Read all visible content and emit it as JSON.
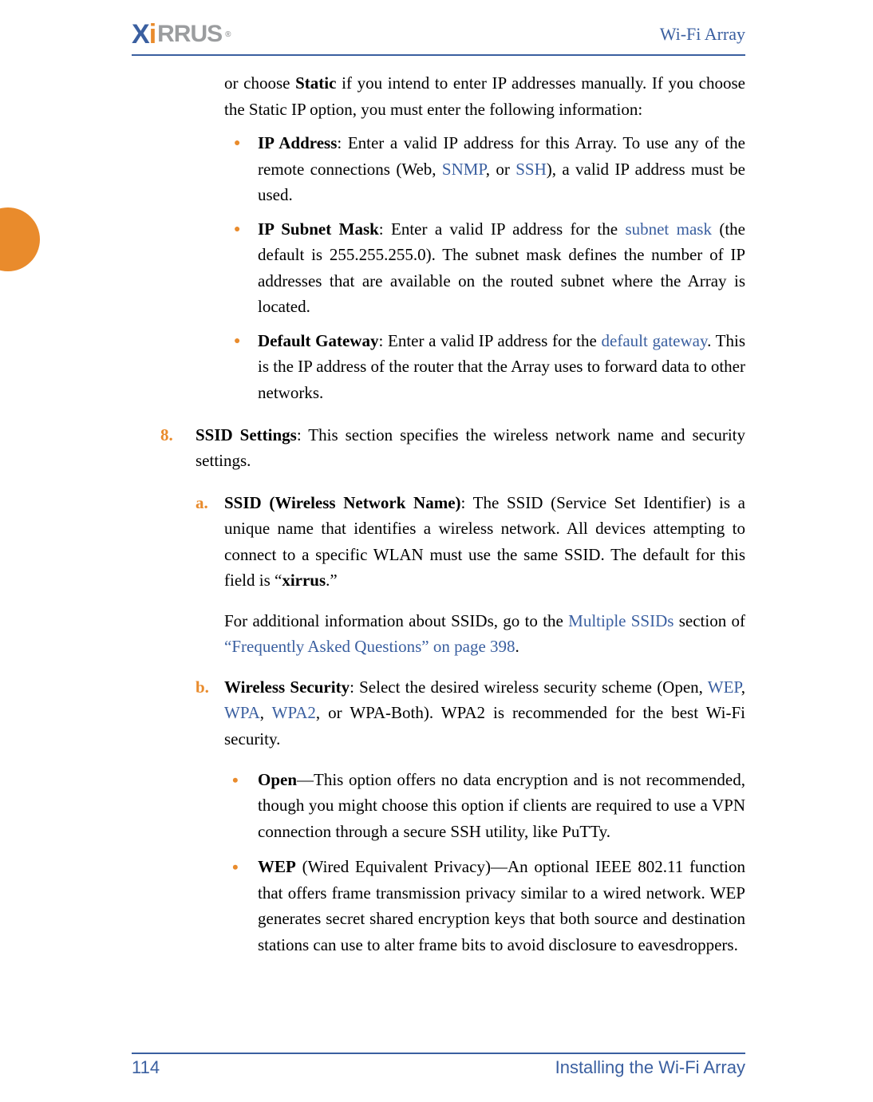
{
  "header": {
    "logo_text_prefix": "X",
    "logo_text_mid": "RRUS",
    "title": "Wi-Fi Array"
  },
  "intro": {
    "prefix": "or choose ",
    "bold1": "Static",
    "suffix": " if you intend to enter IP addresses manually. If you choose the Static IP option, you must enter the following information:"
  },
  "bullets": [
    {
      "label": "IP Address",
      "t1": ": Enter a valid IP address for this Array. To use any of the remote connections (Web, ",
      "link1": "SNMP",
      "t2": ", or ",
      "link2": "SSH",
      "t3": "), a valid IP address must be used."
    },
    {
      "label": "IP Subnet Mask",
      "t1": ": Enter a valid IP address for the ",
      "link1": "subnet mask",
      "t2": " (the default is 255.255.255.0). The subnet mask defines the number of IP addresses that are available on the routed subnet where the Array is located."
    },
    {
      "label": "Default Gateway",
      "t1": ": Enter a valid IP address for the ",
      "link1": "default gateway",
      "t2": ". This is the IP address of the router that the Array uses to forward data to other networks."
    }
  ],
  "step8": {
    "num": "8.",
    "label": "SSID Settings",
    "body": ": This section specifies the wireless network name and security settings."
  },
  "sub_a": {
    "letter": "a.",
    "label": "SSID (Wireless Network Name)",
    "t1": ": The SSID (Service Set Identifier) is a unique name that identifies a wireless network. All devices attempting to connect to a specific WLAN must use the same SSID. The default for this field is “",
    "bold_inside": "xirrus",
    "t1b": ".”",
    "p2_pre": "For additional information about SSIDs, go to the ",
    "p2_link1": "Multiple SSIDs",
    "p2_mid": " section of ",
    "p2_link2": "“Frequently Asked Questions” on page 398",
    "p2_end": "."
  },
  "sub_b": {
    "letter": "b.",
    "label": "Wireless Security",
    "t1": ": Select the desired wireless security scheme (Open, ",
    "link1": "WEP",
    "t2": ", ",
    "link2": "WPA",
    "t3": ", ",
    "link3": "WPA2",
    "t4": ", or WPA-Both). WPA2 is recommended for the best Wi-Fi security."
  },
  "inner_items": [
    {
      "label": "Open",
      "body": "—This option offers no data encryption and is not recommended, though you might choose this option if clients are required to use a VPN connection through a secure SSH utility, like PuTTy."
    },
    {
      "label": "WEP",
      "body": " (Wired Equivalent Privacy)—An optional IEEE 802.11 function that offers frame transmission privacy similar to a wired network. WEP generates secret shared encryption keys that both source and destination stations can use to alter frame bits to avoid disclosure to eavesdroppers."
    }
  ],
  "footer": {
    "page": "114",
    "section": "Installing the Wi-Fi Array"
  }
}
